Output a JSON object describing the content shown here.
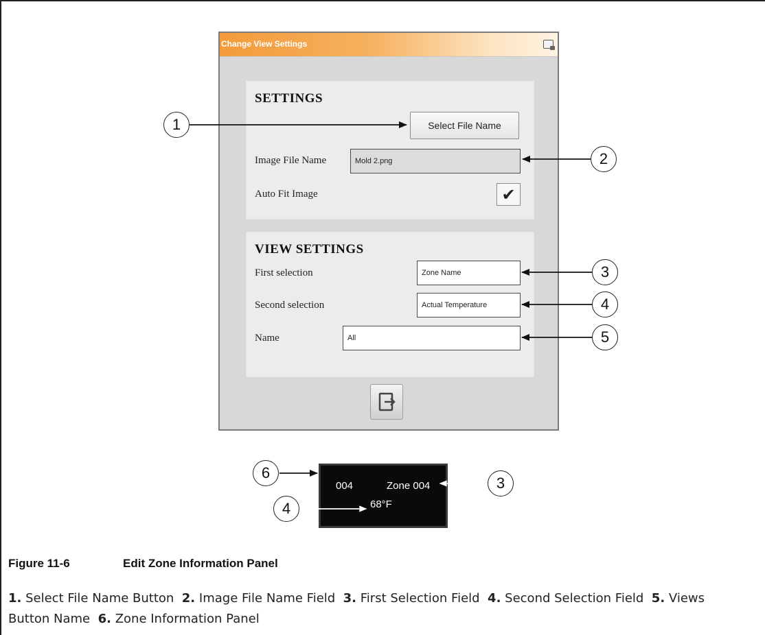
{
  "dialog": {
    "title": "Change View Settings",
    "settings": {
      "heading": "SETTINGS",
      "select_button": "Select File Name",
      "image_label": "Image File Name",
      "image_value": "Mold 2.png",
      "autofit_label": "Auto Fit Image",
      "autofit_checked": true,
      "check_glyph": "✔"
    },
    "view_settings": {
      "heading": "VIEW SETTINGS",
      "first_label": "First selection",
      "first_value": "Zone Name",
      "second_label": "Second selection",
      "second_value": "Actual Temperature",
      "name_label": "Name",
      "name_value": "All"
    },
    "exit_icon": "exit-icon"
  },
  "zone_panel": {
    "number": "004",
    "name": "Zone 004",
    "temperature": "68°F"
  },
  "callouts": [
    "1",
    "2",
    "3",
    "4",
    "5",
    "6",
    "3",
    "4"
  ],
  "caption": {
    "figure_number": "Figure 11-6",
    "figure_title": "Edit Zone Information Panel"
  },
  "legend": [
    {
      "num": "1.",
      "text": "Select File Name Button"
    },
    {
      "num": "2.",
      "text": "Image File Name Field"
    },
    {
      "num": "3.",
      "text": "First Selection Field"
    },
    {
      "num": "4.",
      "text": "Second Selection Field"
    },
    {
      "num": "5.",
      "text": "Views Button Name"
    },
    {
      "num": "6.",
      "text": "Zone Information Panel"
    }
  ]
}
